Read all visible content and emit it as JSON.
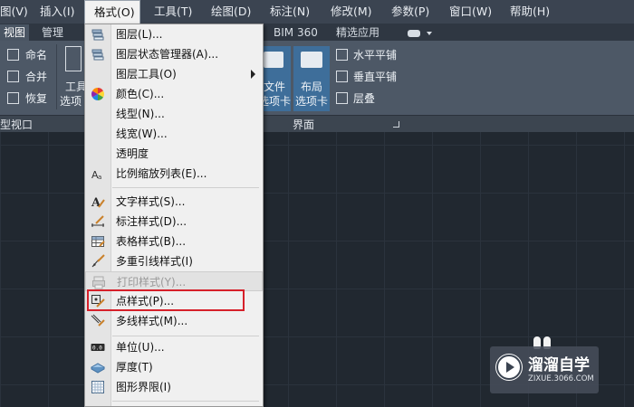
{
  "menubar": {
    "items": [
      "图(V)",
      "插入(I)",
      "格式(O)",
      "工具(T)",
      "绘图(D)",
      "标注(N)",
      "修改(M)",
      "参数(P)",
      "窗口(W)",
      "帮助(H)"
    ],
    "active_index": 2
  },
  "ribbon_tabs": {
    "items": [
      "视图",
      "管理",
      "BIM 360",
      "精选应用"
    ],
    "active_index": 0
  },
  "ribbon": {
    "viewport_rows": [
      "命名",
      "合并",
      "恢复"
    ],
    "tools_label_line1": "工具",
    "tools_label_line2": "选项",
    "file_tab_line1": "文件",
    "file_tab_line2": "选项卡",
    "layout_tab_line1": "布局",
    "layout_tab_line2": "选项卡",
    "tile_items": [
      "水平平铺",
      "垂直平铺",
      "层叠"
    ],
    "panel_left_label": "型视口",
    "panel_interface_label": "界面",
    "accent": "#3e6e9a"
  },
  "format_menu": {
    "items": [
      {
        "label": "图层(L)...",
        "icon": "layers-icon"
      },
      {
        "label": "图层状态管理器(A)...",
        "icon": "layer-state-icon"
      },
      {
        "label": "图层工具(O)",
        "icon": "",
        "submenu": true
      },
      {
        "label": "颜色(C)...",
        "icon": "color-wheel-icon"
      },
      {
        "label": "线型(N)...",
        "icon": ""
      },
      {
        "label": "线宽(W)...",
        "icon": ""
      },
      {
        "label": "透明度",
        "icon": ""
      },
      {
        "label": "比例缩放列表(E)...",
        "icon": "scale-list-icon"
      },
      {
        "label": "文字样式(S)...",
        "icon": "text-style-icon"
      },
      {
        "label": "标注样式(D)...",
        "icon": "dimension-style-icon"
      },
      {
        "label": "表格样式(B)...",
        "icon": "table-style-icon"
      },
      {
        "label": "多重引线样式(I)",
        "icon": "multileader-style-icon"
      },
      {
        "label": "打印样式(Y)...",
        "icon": "print-style-icon",
        "disabled": true
      },
      {
        "label": "点样式(P)...",
        "icon": "point-style-icon",
        "highlighted": true
      },
      {
        "label": "多线样式(M)...",
        "icon": "multiline-style-icon"
      },
      {
        "label": "单位(U)...",
        "icon": "units-icon"
      },
      {
        "label": "厚度(T)",
        "icon": "thickness-icon"
      },
      {
        "label": "图形界限(I)",
        "icon": "drawing-limits-icon"
      }
    ],
    "highlight_color": "#d6202a"
  },
  "watermark": {
    "title": "溜溜自学",
    "url": "ZIXUE.3066.COM"
  }
}
